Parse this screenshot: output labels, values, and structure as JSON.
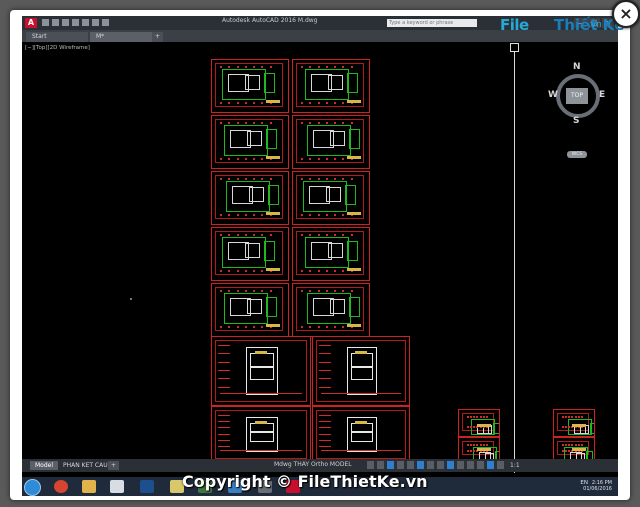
{
  "app": {
    "title": "Autodesk AutoCAD 2016    M.dwg",
    "logo_letter": "A",
    "search_placeholder": "Type a keyword or phrase",
    "window_buttons": [
      "–",
      "□",
      "✕"
    ]
  },
  "tabs": [
    {
      "label": "Start"
    },
    {
      "label": "M*"
    },
    {
      "label": "+"
    }
  ],
  "viewport": {
    "label": "[−][Top][2D Wireframe]"
  },
  "viewcube": {
    "top_label": "TOP",
    "n": "N",
    "s": "S",
    "e": "E",
    "w": "W",
    "wcs_label": "WCS"
  },
  "status": {
    "tabs": [
      {
        "label": "Model",
        "active": true
      },
      {
        "label": "PHAN KET CAU",
        "active": false
      },
      {
        "label": "+",
        "active": false
      }
    ],
    "command": "Mdwg THAY Ortho    MODEL",
    "scale": "1:1"
  },
  "taskbar": {
    "lang": "EN",
    "time": "2:16 PM",
    "date": "01/06/2016"
  },
  "watermark": {
    "logo_part1": "File",
    "logo_part2": "Thiết Kế",
    "logo_part3": ".vn",
    "bottom": "Copyright © FileThietKe.vn"
  },
  "close_symbol": "×",
  "colors": {
    "sheet_border": "#cc2222",
    "plan_lines": "#1fb81f",
    "accent_blue": "#27a8d6"
  }
}
